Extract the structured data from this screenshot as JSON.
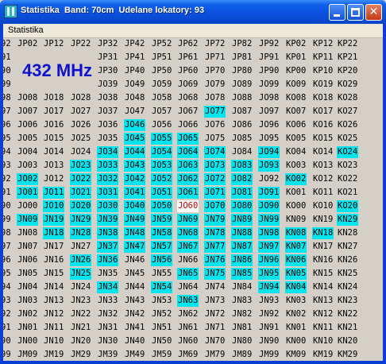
{
  "window": {
    "title": "Statistika  Band: 70cm  Udelane lokatory: 93",
    "minimize_icon": "minimize-icon",
    "maximize_icon": "maximize-icon",
    "close_icon": "close-icon",
    "close_glyph": "✕"
  },
  "menu": {
    "items": [
      "Statistika"
    ]
  },
  "freq_label": "432 MHz",
  "colors": {
    "highlight": "#00e5ee",
    "current": "#d40000",
    "freq": "#1010d0"
  },
  "grid": {
    "rows": [
      [
        "92",
        "JP02",
        "JP12",
        "JP22",
        "JP32",
        "JP42",
        "JP52",
        "JP62",
        "JP72",
        "JP82",
        "JP92",
        "KP02",
        "KP12",
        "KP22"
      ],
      [
        "91",
        "",
        "",
        "",
        "JP31",
        "JP41",
        "JP51",
        "JP61",
        "JP71",
        "JP81",
        "JP91",
        "KP01",
        "KP11",
        "KP21"
      ],
      [
        "90",
        "",
        "",
        "",
        "JP30",
        "JP40",
        "JP50",
        "JP60",
        "JP70",
        "JP80",
        "JP90",
        "KP00",
        "KP10",
        "KP20"
      ],
      [
        "99",
        "",
        "",
        "",
        "JO39",
        "JO49",
        "JO59",
        "JO69",
        "JO79",
        "JO89",
        "JO99",
        "KO09",
        "KO19",
        "KO29"
      ],
      [
        "98",
        "JO08",
        "JO18",
        "JO28",
        "JO38",
        "JO48",
        "JO58",
        "JO68",
        "JO78",
        "JO88",
        "JO98",
        "KO08",
        "KO18",
        "KO28"
      ],
      [
        "97",
        "JO07",
        "JO17",
        "JO27",
        "JO37",
        "JO47",
        "JO57",
        "JO67",
        "JO77",
        "JO87",
        "JO97",
        "KO07",
        "KO17",
        "KO27"
      ],
      [
        "96",
        "JO06",
        "JO16",
        "JO26",
        "JO36",
        "JO46",
        "JO56",
        "JO66",
        "JO76",
        "JO86",
        "JO96",
        "KO06",
        "KO16",
        "KO26"
      ],
      [
        "95",
        "JO05",
        "JO15",
        "JO25",
        "JO35",
        "JO45",
        "JO55",
        "JO65",
        "JO75",
        "JO85",
        "JO95",
        "KO05",
        "KO15",
        "KO25"
      ],
      [
        "94",
        "JO04",
        "JO14",
        "JO24",
        "JO34",
        "JO44",
        "JO54",
        "JO64",
        "JO74",
        "JO84",
        "JO94",
        "KO04",
        "KO14",
        "KO24"
      ],
      [
        "93",
        "JO03",
        "JO13",
        "JO23",
        "JO33",
        "JO43",
        "JO53",
        "JO63",
        "JO73",
        "JO83",
        "JO93",
        "KO03",
        "KO13",
        "KO23"
      ],
      [
        "92",
        "JO02",
        "JO12",
        "JO22",
        "JO32",
        "JO42",
        "JO52",
        "JO62",
        "JO72",
        "JO82",
        "JO92",
        "KO02",
        "KO12",
        "KO22"
      ],
      [
        "91",
        "JO01",
        "JO11",
        "JO21",
        "JO31",
        "JO41",
        "JO51",
        "JO61",
        "JO71",
        "JO81",
        "JO91",
        "KO01",
        "KO11",
        "KO21"
      ],
      [
        "90",
        "JO00",
        "JO10",
        "JO20",
        "JO30",
        "JO40",
        "JO50",
        "JO60",
        "JO70",
        "JO80",
        "JO90",
        "KO00",
        "KO10",
        "KO20"
      ],
      [
        "99",
        "JN09",
        "JN19",
        "JN29",
        "JN39",
        "JN49",
        "JN59",
        "JN69",
        "JN79",
        "JN89",
        "JN99",
        "KN09",
        "KN19",
        "KN29"
      ],
      [
        "98",
        "JN08",
        "JN18",
        "JN28",
        "JN38",
        "JN48",
        "JN58",
        "JN68",
        "JN78",
        "JN88",
        "JN98",
        "KN08",
        "KN18",
        "KN28"
      ],
      [
        "97",
        "JN07",
        "JN17",
        "JN27",
        "JN37",
        "JN47",
        "JN57",
        "JN67",
        "JN77",
        "JN87",
        "JN97",
        "KN07",
        "KN17",
        "KN27"
      ],
      [
        "96",
        "JN06",
        "JN16",
        "JN26",
        "JN36",
        "JN46",
        "JN56",
        "JN66",
        "JN76",
        "JN86",
        "JN96",
        "KN06",
        "KN16",
        "KN26"
      ],
      [
        "95",
        "JN05",
        "JN15",
        "JN25",
        "JN35",
        "JN45",
        "JN55",
        "JN65",
        "JN75",
        "JN85",
        "JN95",
        "KN05",
        "KN15",
        "KN25"
      ],
      [
        "94",
        "JN04",
        "JN14",
        "JN24",
        "JN34",
        "JN44",
        "JN54",
        "JN64",
        "JN74",
        "JN84",
        "JN94",
        "KN04",
        "KN14",
        "KN24"
      ],
      [
        "93",
        "JN03",
        "JN13",
        "JN23",
        "JN33",
        "JN43",
        "JN53",
        "JN63",
        "JN73",
        "JN83",
        "JN93",
        "KN03",
        "KN13",
        "KN23"
      ],
      [
        "92",
        "JN02",
        "JN12",
        "JN22",
        "JN32",
        "JN42",
        "JN52",
        "JN62",
        "JN72",
        "JN82",
        "JN92",
        "KN02",
        "KN12",
        "KN22"
      ],
      [
        "91",
        "JN01",
        "JN11",
        "JN21",
        "JN31",
        "JN41",
        "JN51",
        "JN61",
        "JN71",
        "JN81",
        "JN91",
        "KN01",
        "KN11",
        "KN21"
      ],
      [
        "90",
        "JN00",
        "JN10",
        "JN20",
        "JN30",
        "JN40",
        "JN50",
        "JN60",
        "JN70",
        "JN80",
        "JN90",
        "KN00",
        "KN10",
        "KN20"
      ],
      [
        "99",
        "JM09",
        "JM19",
        "JM29",
        "JM39",
        "JM49",
        "JM59",
        "JM69",
        "JM79",
        "JM89",
        "JM99",
        "KM09",
        "KM19",
        "KM29"
      ]
    ],
    "highlighted": [
      "JO77",
      "JO46",
      "JO45",
      "JO55",
      "JO65",
      "JO34",
      "JO44",
      "JO54",
      "JO64",
      "JO74",
      "JO94",
      "KO24",
      "JO23",
      "JO33",
      "JO43",
      "JO53",
      "JO63",
      "JO73",
      "JO83",
      "JO93",
      "JO02",
      "JO22",
      "JO32",
      "JO42",
      "JO52",
      "JO62",
      "JO72",
      "JO82",
      "KO02",
      "JO01",
      "JO11",
      "JO21",
      "JO31",
      "JO41",
      "JO51",
      "JO61",
      "JO71",
      "JO81",
      "JO91",
      "JO10",
      "JO20",
      "JO30",
      "JO40",
      "JO50",
      "JO70",
      "JO80",
      "JO90",
      "KO20",
      "JN09",
      "JN19",
      "JN29",
      "JN39",
      "JN49",
      "JN59",
      "JN69",
      "JN79",
      "JN89",
      "JN99",
      "KN29",
      "JN18",
      "JN28",
      "JN38",
      "JN48",
      "JN58",
      "JN68",
      "JN78",
      "JN88",
      "JN98",
      "KN08",
      "KN18",
      "JN37",
      "JN47",
      "JN57",
      "JN67",
      "JN77",
      "JN87",
      "JN97",
      "KN07",
      "JN26",
      "JN36",
      "JN56",
      "JN76",
      "JN86",
      "JN96",
      "KN06",
      "JN25",
      "JN65",
      "JN75",
      "JN85",
      "JN95",
      "KN05",
      "JN34",
      "JN54",
      "JN94",
      "KN04",
      "JN63"
    ],
    "current": "JO60"
  }
}
